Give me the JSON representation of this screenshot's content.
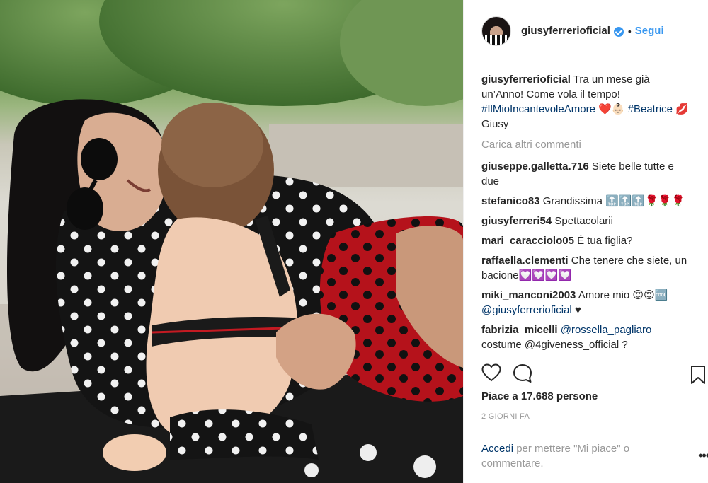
{
  "post": {
    "username": "giusyferrerioficial",
    "follow_label": "Segui",
    "separator": "•",
    "caption_user": "giusyferrerioficial",
    "caption_text": "Tra un mese già un’Anno! Come vola il tempo!",
    "caption_hashtag1": "#IlMioIncantevoleAmore",
    "caption_emoji1": "❤️👶🏻",
    "caption_hashtag2": "#Beatrice",
    "caption_emoji2": "💋",
    "caption_sign": "Giusy",
    "load_more": "Carica altri commenti",
    "likes": "Piace a 17.688 persone",
    "time_ago": "2 GIORNI FA"
  },
  "comments": [
    {
      "user": "giuseppe.galletta.716",
      "text": "Siete belle tutte e due"
    },
    {
      "user": "stefanico83",
      "text": "Grandissima 🔝🔝🔝🌹🌹🌹"
    },
    {
      "user": "giusyferreri54",
      "text": "Spettacolarii"
    },
    {
      "user": "mari_caracciolo05",
      "text": "È tua figlia?"
    },
    {
      "user": "raffaella.clementi",
      "text": "Che tenere che siete, un bacione💟💟💟💟"
    },
    {
      "user": "miki_manconi2003",
      "text": "Amore mio 😍😍🆒",
      "mention": "@giusyferrerioficial",
      "after": "♥"
    },
    {
      "user": "fabrizia_micelli",
      "text": "",
      "mention": "@rossella_pagliaro",
      "after": "costume @4giveness_official ?"
    }
  ],
  "login": {
    "link": "Accedi",
    "text": "per mettere \"Mi piace\" o commentare."
  },
  "icons": [
    "heart-icon",
    "comment-icon",
    "bookmark-icon",
    "more-options-icon",
    "verified-badge-icon"
  ],
  "colors": {
    "link": "#3897f0",
    "hashtag": "#003569",
    "muted": "#999999",
    "text": "#262626"
  }
}
